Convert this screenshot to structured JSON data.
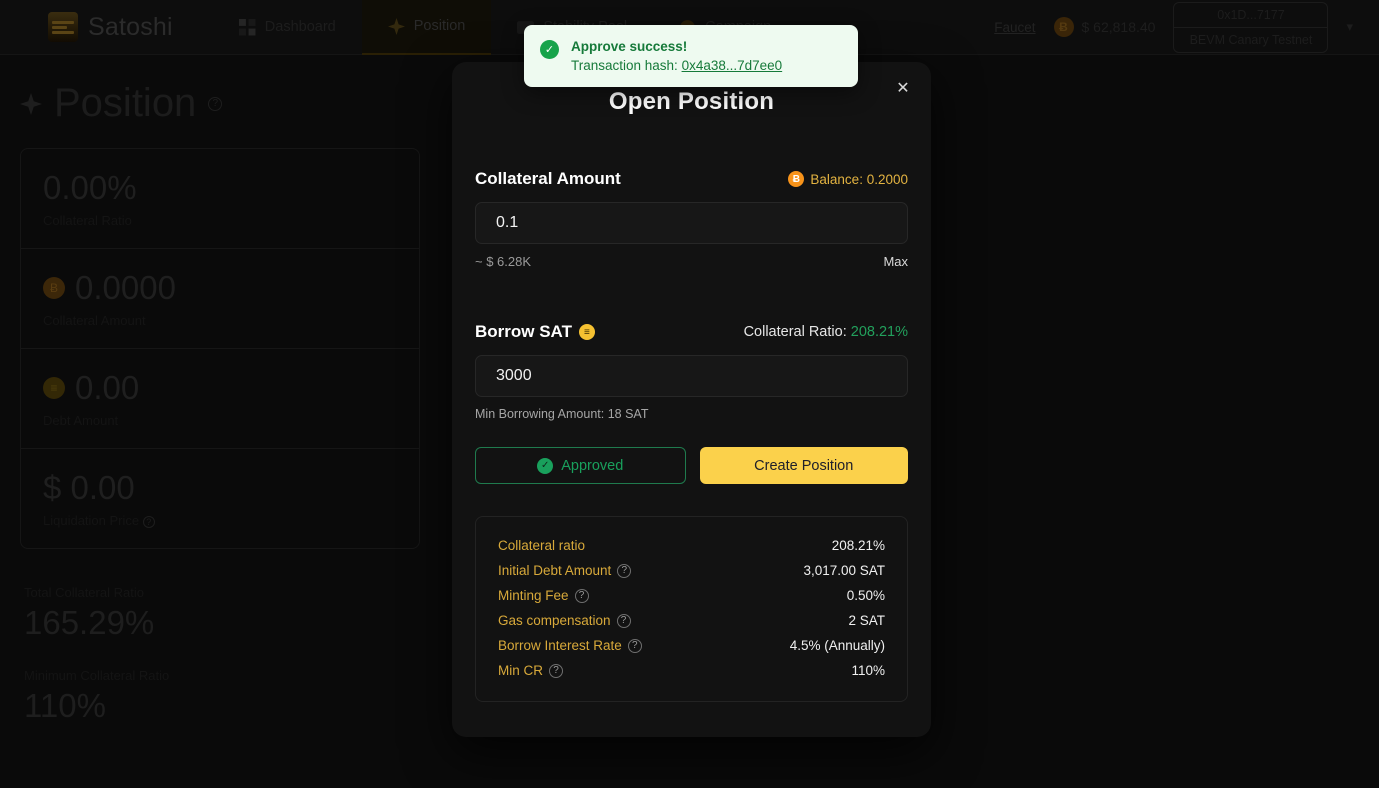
{
  "nav": {
    "brand": "Satoshi",
    "tabs": [
      {
        "label": "Dashboard",
        "icon": "grid-icon",
        "active": false
      },
      {
        "label": "Position",
        "icon": "position-icon",
        "active": true
      },
      {
        "label": "Stability Pool",
        "icon": "pool-icon",
        "active": false
      },
      {
        "label": "Campaign",
        "icon": "campaign-icon",
        "active": false
      }
    ],
    "faucet": "Faucet",
    "price": "$ 62,818.40",
    "btc_symbol": "Ƀ",
    "wallet_address": "0x1D...7177",
    "network": "BEVM Canary Testnet",
    "chevron": "▾"
  },
  "page": {
    "title": "Position",
    "help": "?",
    "stats": [
      {
        "value": "0.00%",
        "label": "Collateral Ratio",
        "icon": ""
      },
      {
        "value": "0.0000",
        "label": "Collateral Amount",
        "icon": "btc"
      },
      {
        "value": "0.00",
        "label": "Debt Amount",
        "icon": "sat"
      },
      {
        "value": "$ 0.00",
        "label": "Liquidation Price",
        "icon": "",
        "has_help": true
      }
    ],
    "totals": [
      {
        "label": "Total Collateral Ratio",
        "value": "165.29%"
      },
      {
        "label": "Minimum Collateral Ratio",
        "value": "110%"
      }
    ]
  },
  "toast": {
    "icon": "check-circle-icon",
    "title": "Approve success!",
    "hash_label": "Transaction hash: ",
    "hash": "0x4a38...7d7ee0"
  },
  "modal": {
    "title": "Open Position",
    "close": "✕",
    "collateral": {
      "label": "Collateral Amount",
      "balance_label": "Balance: 0.2000",
      "balance_icon": "Ƀ",
      "value": "0.1",
      "placeholder": "0.00",
      "usd": "~ $ 6.28K",
      "max": "Max"
    },
    "borrow": {
      "label": "Borrow SAT",
      "token_icon": "≡",
      "ratio_label": "Collateral Ratio: ",
      "ratio_value": "208.21%",
      "value": "3000",
      "placeholder": "0",
      "hint": "Min Borrowing Amount: 18 SAT"
    },
    "actions": {
      "approved": "Approved",
      "approved_icon": "✓",
      "create": "Create Position"
    },
    "summary": [
      {
        "key": "Collateral ratio",
        "help": false,
        "value": "208.21%"
      },
      {
        "key": "Initial Debt Amount",
        "help": true,
        "value": "3,017.00 SAT"
      },
      {
        "key": "Minting Fee",
        "help": true,
        "value": "0.50%"
      },
      {
        "key": "Gas compensation",
        "help": true,
        "value": "2 SAT"
      },
      {
        "key": "Borrow Interest Rate",
        "help": true,
        "value": "4.5% (Annually)"
      },
      {
        "key": "Min CR",
        "help": true,
        "value": "110%"
      }
    ]
  },
  "colors": {
    "accent_yellow": "#fbd14b",
    "accent_green": "#19a05c",
    "btc_orange": "#f7931a",
    "summary_key": "#d8a93a"
  }
}
